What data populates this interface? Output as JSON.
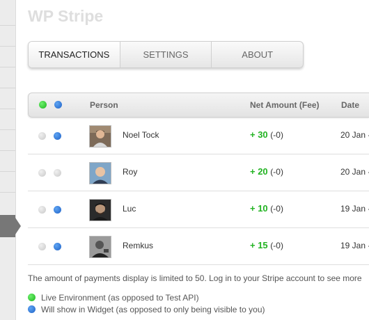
{
  "app": {
    "title": "WP Stripe"
  },
  "tabs": [
    {
      "label": "TRANSACTIONS",
      "active": true
    },
    {
      "label": "SETTINGS",
      "active": false
    },
    {
      "label": "ABOUT",
      "active": false
    }
  ],
  "table": {
    "columns": {
      "person": "Person",
      "net_amount": "Net Amount (Fee)",
      "date": "Date"
    },
    "rows": [
      {
        "live": false,
        "widget": true,
        "name": "Noel Tock",
        "amount": "+ 30",
        "fee": "(-0)",
        "date": "20 Jan -",
        "avatar_icon": "avatar-noel-tock-icon"
      },
      {
        "live": false,
        "widget": false,
        "name": "Roy",
        "amount": "+ 20",
        "fee": "(-0)",
        "date": "20 Jan -",
        "avatar_icon": "avatar-roy-icon"
      },
      {
        "live": false,
        "widget": true,
        "name": "Luc",
        "amount": "+ 10",
        "fee": "(-0)",
        "date": "19 Jan -",
        "avatar_icon": "avatar-luc-icon"
      },
      {
        "live": false,
        "widget": true,
        "name": "Remkus",
        "amount": "+ 15",
        "fee": "(-0)",
        "date": "19 Jan -",
        "avatar_icon": "avatar-remkus-icon"
      }
    ]
  },
  "footer": {
    "note": "The amount of payments display is limited to 50. Log in to your Stripe account to see more",
    "legend_live": "Live Environment (as opposed to Test API)",
    "legend_widget": "Will show in Widget (as opposed to only being visible to you)"
  },
  "colors": {
    "live_dot": "#1bb41b",
    "widget_dot": "#1f62c7",
    "inactive_dot": "#c8c8c8",
    "amount_positive": "#22b322"
  }
}
